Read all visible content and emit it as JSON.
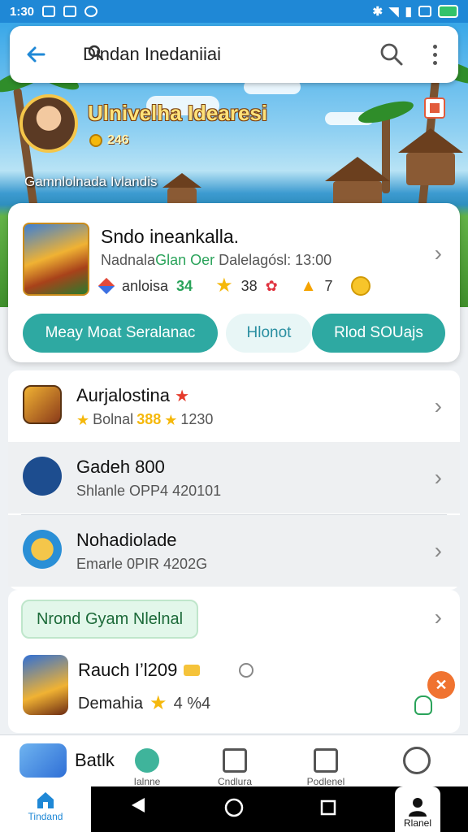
{
  "status_bar": {
    "time": "1:30"
  },
  "search": {
    "back_icon": "arrow-left-icon",
    "query": "Dindan Inedaniiai"
  },
  "profile": {
    "name": "Ulnivelha Idearesi",
    "coins": "246",
    "location": "Gamnlolnada Ivlandis"
  },
  "featured": {
    "title": "Sndo ineankalla.",
    "subtitle_prefix": "Nadnala",
    "subtitle_accent": "Glan Oer",
    "subtitle_suffix": " Dalelagósl: 13:00",
    "stat_label": "anloisa",
    "stat_value": "34",
    "star_value": "38",
    "bell_value": "7",
    "buttons": {
      "left": "Meay Moat Seralanac",
      "middle": "Hlonot",
      "right": "Rlod SOUajs"
    }
  },
  "list": [
    {
      "title": "Aurjalostina",
      "sub_a": "Bolnal",
      "sub_hl": "388",
      "sub_b": "1230"
    },
    {
      "title": "Gadeh 800",
      "sub": "Shlanle OPP4 420101"
    },
    {
      "title": "Nohadiolade",
      "sub": "Emarle 0PIR 4202G"
    }
  ],
  "bottom": {
    "chip": "Nrond Gyam Nlelnal",
    "item_title": "Rauch I’l209",
    "item_sub": "Demahia",
    "item_value": "4 %4"
  },
  "tabs": {
    "t1_big": "Batlk",
    "t2": "Ialnne",
    "t3": "Cndlura",
    "t4": "Podlenel",
    "home": "Tindand",
    "profile": "Rlanel"
  },
  "colors": {
    "accent": "#1f88d6",
    "teal": "#2ea9a2",
    "orange": "#f07330"
  }
}
